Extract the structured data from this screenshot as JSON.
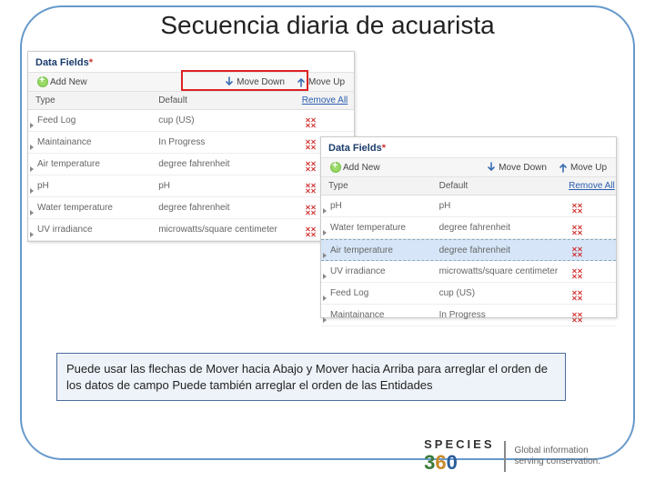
{
  "title": "Secuencia diaria de acuarista",
  "panel": {
    "label": "Data Fields",
    "asterisk": "*",
    "add": "Add New",
    "moveDown": "Move Down",
    "moveUp": "Move Up",
    "col_type": "Type",
    "col_default": "Default",
    "removeAll": "Remove All"
  },
  "rows1": [
    {
      "type": "Feed Log",
      "def": "cup (US)"
    },
    {
      "type": "Maintainance",
      "def": "In Progress"
    },
    {
      "type": "Air temperature",
      "def": "degree fahrenheit"
    },
    {
      "type": "pH",
      "def": "pH"
    },
    {
      "type": "Water temperature",
      "def": "degree fahrenheit"
    },
    {
      "type": "UV irradiance",
      "def": "microwatts/square centimeter"
    }
  ],
  "rows2": [
    {
      "type": "pH",
      "def": "pH"
    },
    {
      "type": "Water temperature",
      "def": "degree fahrenheit"
    },
    {
      "type": "Air temperature",
      "def": "degree fahrenheit",
      "sel": true
    },
    {
      "type": "UV irradiance",
      "def": "microwatts/square centimeter"
    },
    {
      "type": "Feed Log",
      "def": "cup (US)"
    },
    {
      "type": "Maintainance",
      "def": "In Progress"
    }
  ],
  "caption": "Puede usar las flechas de Mover hacia Abajo y Mover hacia Arriba para arreglar el orden de los datos de campo Puede también arreglar el orden de las Entidades",
  "logo": {
    "brand": "SPECIES",
    "tag1": "Global information",
    "tag2": "serving conservation."
  }
}
